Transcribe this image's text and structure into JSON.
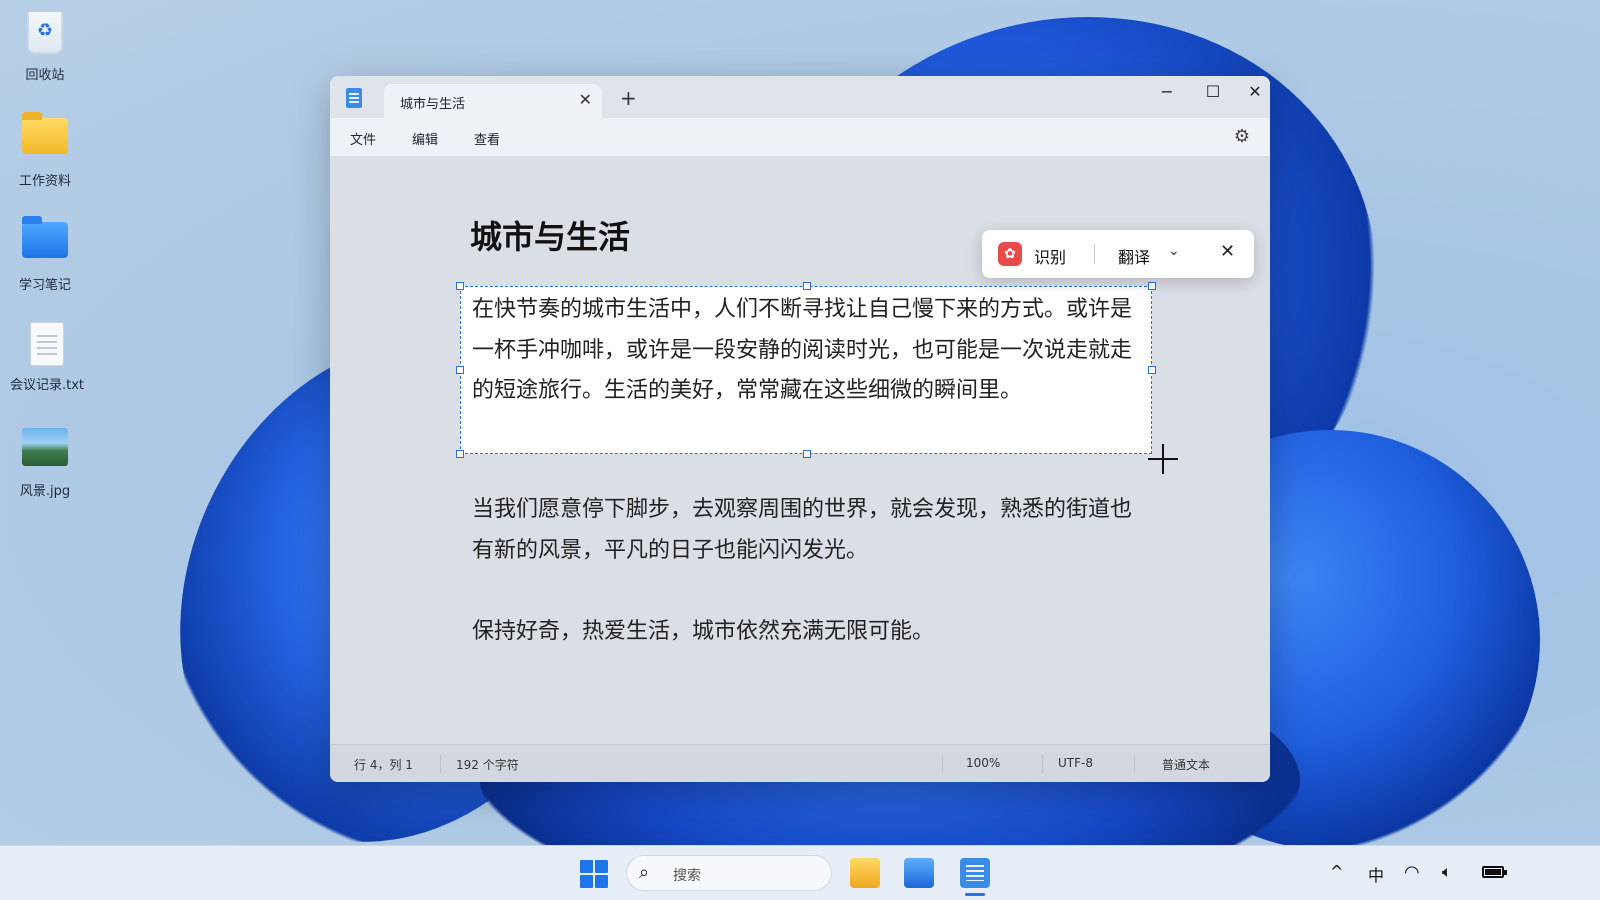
{
  "desktop": {
    "icons": [
      {
        "label": "回收站"
      },
      {
        "label": "工作资料"
      },
      {
        "label": "学习笔记"
      },
      {
        "label": "会议记录.txt"
      },
      {
        "label": "风景.jpg"
      }
    ]
  },
  "window": {
    "tab_title": "城市与生活",
    "new_tab": "+",
    "minimize": "−",
    "maximize": "☐",
    "close": "✕",
    "tab_close": "✕",
    "menu": [
      "文件",
      "编辑",
      "查看"
    ],
    "settings_icon": "gear-icon"
  },
  "document": {
    "title": "城市与生活",
    "paragraphs": [
      "在快节奏的城市生活中，人们不断寻找让自己慢下来的方式。或许是一杯手冲咖啡，或许是一段安静的阅读时光，也可能是一次说走就走的短途旅行。生活的美好，常常藏在这些细微的瞬间里。",
      "当我们愿意停下脚步，去观察周围的世界，就会发现，熟悉的街道也有新的风景，平凡的日子也能闪闪发光。",
      "保持好奇，热爱生活，城市依然充满无限可能。"
    ]
  },
  "statusbar": {
    "position": "行 4，列 1",
    "chars": "192 个字符",
    "zoom": "100%",
    "encoding": "UTF-8",
    "format": "普通文本"
  },
  "ocr_toolbar": {
    "recognize": "识别",
    "translate": "翻译",
    "chevron": "⌄",
    "close": "✕"
  },
  "taskbar": {
    "search_placeholder": "搜索",
    "ime": "中",
    "tray_up": "^",
    "wifi": "wifi-icon",
    "volume": "volume-icon",
    "battery": "battery-icon"
  },
  "colors": {
    "accent": "#1e74e8",
    "selection_border": "#2a6fe0",
    "ocr_logo": "#e94a4a"
  }
}
